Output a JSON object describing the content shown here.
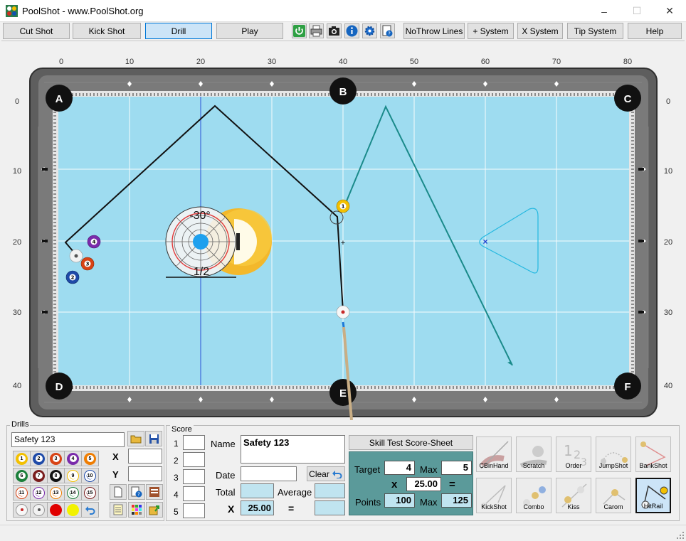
{
  "window": {
    "title": "PoolShot - www.PoolShot.org",
    "minimize": "–",
    "maximize": "☐",
    "close": "✕"
  },
  "toolbar": {
    "modes": [
      "Cut Shot",
      "Kick Shot",
      "Drill",
      "Play"
    ],
    "active_mode": "Drill",
    "icons": [
      "power-icon",
      "print-icon",
      "camera-icon",
      "info-icon",
      "settings-icon",
      "help-doc-icon"
    ],
    "buttons": [
      "NoThrow Lines",
      "+ System",
      "X System",
      "Tip System",
      "Help"
    ]
  },
  "table": {
    "x_ticks": [
      "0",
      "10",
      "20",
      "30",
      "40",
      "50",
      "60",
      "70",
      "80"
    ],
    "y_ticks": [
      "0",
      "10",
      "20",
      "30",
      "40"
    ],
    "pockets": [
      "A",
      "B",
      "C",
      "D",
      "E",
      "F"
    ],
    "aim_angle": "-30°",
    "aim_fraction": "1/2",
    "colors": {
      "felt": "#9edcf0",
      "felt_dark": "#7fc8e4",
      "rail": "#6d6d6d",
      "shot_path": "#000000",
      "target_path": "#1a8a8a",
      "target_zone": "#25b8e0"
    },
    "balls_on_table": [
      "1",
      "2",
      "3",
      "4",
      "cue"
    ]
  },
  "drills": {
    "group_label": "Drills",
    "name_value": "Safety 123",
    "ball_buttons": [
      "1",
      "2",
      "3",
      "4",
      "5",
      "6",
      "7",
      "8",
      "9",
      "10",
      "11",
      "12",
      "13",
      "14",
      "15",
      "cue",
      "spot",
      "red",
      "yellow",
      "undo"
    ],
    "x_label": "X",
    "y_label": "Y",
    "x_value": "",
    "y_value": ""
  },
  "score": {
    "group_label": "Score",
    "rows": [
      "1",
      "2",
      "3",
      "4",
      "5"
    ],
    "name_label": "Name",
    "name_value": "Safety 123",
    "date_label": "Date",
    "date_value": "",
    "clear_label": "Clear",
    "total_label": "Total",
    "average_label": "Average",
    "x_label": "X",
    "multiplier": "25.00",
    "equals": "="
  },
  "skill_test": {
    "header": "Skill Test Score-Sheet",
    "target_label": "Target",
    "target_value": "4",
    "max_label": "Max",
    "max_value": "5",
    "x_label": "x",
    "multiplier": "25.00",
    "equals": "=",
    "points_label": "Points",
    "points_value": "100",
    "points_max_label": "Max",
    "points_max_value": "125"
  },
  "drill_types": [
    "CBinHand",
    "Scratch",
    "Order",
    "JumpShot",
    "BankShot",
    "KickShot",
    "Combo",
    "Kiss",
    "Carom",
    "HitRail"
  ],
  "active_drill_type": "HitRail"
}
